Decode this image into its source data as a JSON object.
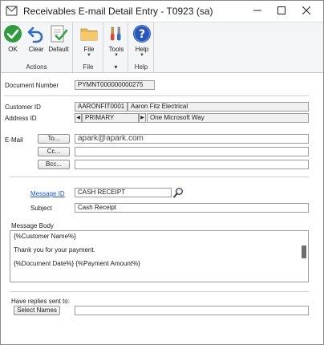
{
  "window": {
    "title": "Receivables E-mail Detail Entry  -  T0923 (sa)"
  },
  "ribbon": {
    "groups": [
      {
        "label": "Actions",
        "buttons": [
          "OK",
          "Clear",
          "Default"
        ]
      },
      {
        "label": "File",
        "buttons": [
          "File"
        ]
      },
      {
        "label": "",
        "buttons": [
          "Tools"
        ]
      },
      {
        "label": "Help",
        "buttons": [
          "Help"
        ]
      }
    ]
  },
  "form": {
    "document_number_label": "Document Number",
    "document_number": "PYMNT000000000275",
    "customer_id_label": "Customer ID",
    "customer_id": "AARONFIT0001",
    "customer_name": "Aaron Fitz Electrical",
    "address_id_label": "Address ID",
    "address_id": "PRIMARY",
    "address_line": "One Microsoft Way",
    "email_label": "E-Mail",
    "to_button": "To...",
    "to_value": "apark@apark.com",
    "cc_button": "Cc...",
    "cc_value": "",
    "bcc_button": "Bcc...",
    "bcc_value": "",
    "message_id_label": "Message ID",
    "message_id": "CASH RECEIPT",
    "subject_label": "Subject",
    "subject": "Cash Receipt",
    "message_body_label": "Message Body",
    "message_lines": [
      "{%Customer Name%}",
      "Thank you for your payment.",
      "{%Document Date%}   {%Payment Amount%}"
    ],
    "replies_label": "Have replies sent to:",
    "select_names_button": "Select Names",
    "replies_value": ""
  },
  "colors": {
    "ok_green": "#2e9b3f",
    "link_blue": "#1b55c9",
    "help_blue": "#2a55b8"
  },
  "icons": [
    "app-icon",
    "checkmark-icon",
    "undo-icon",
    "document-check-icon",
    "folder-icon",
    "tools-icon",
    "help-icon",
    "magnifier-icon"
  ]
}
